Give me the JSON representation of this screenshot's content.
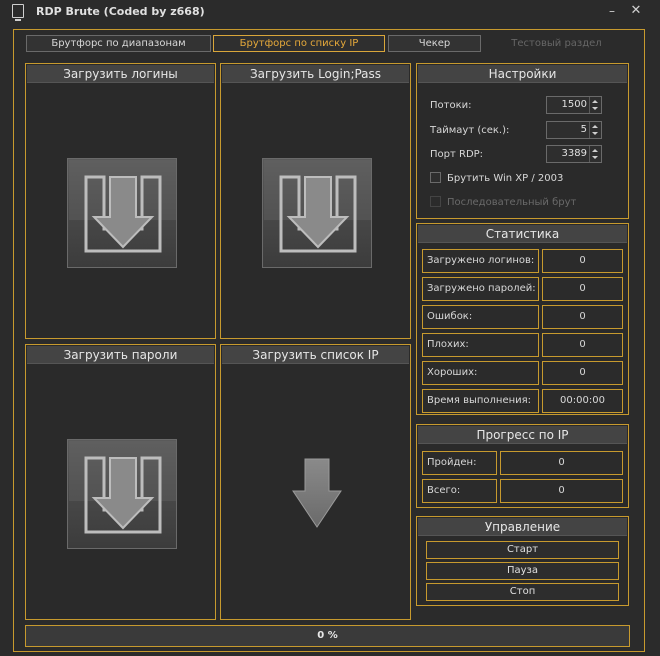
{
  "window": {
    "title": "RDP Brute (Coded by z668)",
    "minimize": "–",
    "close": "✕"
  },
  "tabs": [
    {
      "label": "Брутфорс по диапазонам"
    },
    {
      "label": "Брутфорс по списку IP"
    },
    {
      "label": "Чекер"
    },
    {
      "label": "Тестовый раздел"
    }
  ],
  "loaders": {
    "logins": "Загрузить логины",
    "loginpass": "Загрузить Login;Pass",
    "passwords": "Загрузить пароли",
    "iplist": "Загрузить список IP"
  },
  "icons": {
    "load": "download-arrow-icon"
  },
  "settings": {
    "title": "Настройки",
    "threads_label": "Потоки:",
    "threads_value": "1500",
    "timeout_label": "Таймаут (сек.):",
    "timeout_value": "5",
    "port_label": "Порт RDP:",
    "port_value": "3389",
    "winxp_label": "Брутить Win XP / 2003",
    "sequential_label": "Последовательный брут"
  },
  "stats": {
    "title": "Статистика",
    "rows": [
      {
        "label": "Загружено логинов:",
        "value": "0"
      },
      {
        "label": "Загружено паролей:",
        "value": "0"
      },
      {
        "label": "Ошибок:",
        "value": "0"
      },
      {
        "label": "Плохих:",
        "value": "0"
      },
      {
        "label": "Хороших:",
        "value": "0"
      },
      {
        "label": "Время выполнения:",
        "value": "00:00:00"
      }
    ]
  },
  "ip_progress": {
    "title": "Прогресс по IP",
    "rows": [
      {
        "label": "Пройден:",
        "value": "0"
      },
      {
        "label": "Всего:",
        "value": "0"
      }
    ]
  },
  "control": {
    "title": "Управление",
    "start": "Старт",
    "pause": "Пауза",
    "stop": "Стоп"
  },
  "progress": {
    "text": "0 %",
    "percent": 0
  },
  "colors": {
    "accent": "#c79a2e",
    "active_tab": "#e6a93a",
    "background": "#2b2b2b"
  }
}
